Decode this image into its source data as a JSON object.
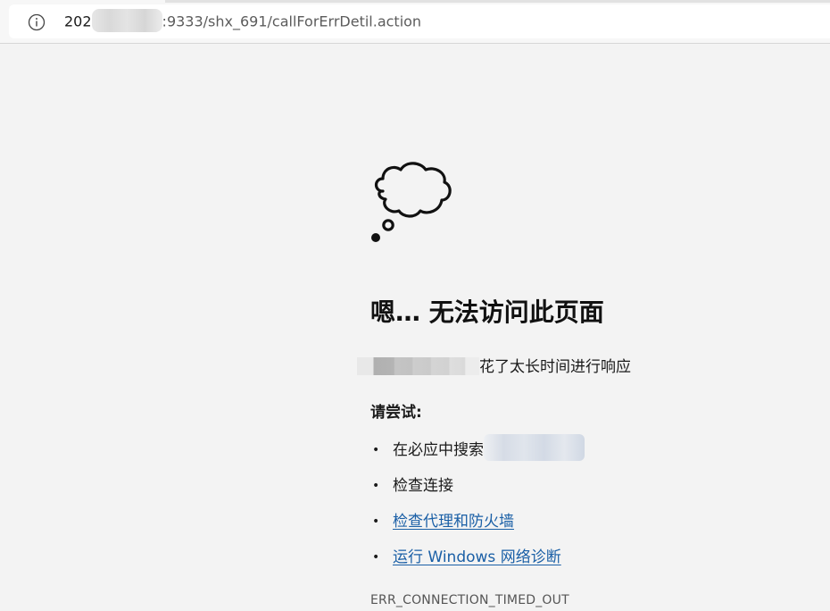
{
  "browser": {
    "url_prefix": "202",
    "url_suffix": ":9333/shx_691/callForErrDetil.action",
    "info_icon": "info-circle-icon"
  },
  "error_page": {
    "illustration_icon": "thought-cloud-icon",
    "title": "嗯… 无法访问此页面",
    "message_suffix": "花了太长时间进行响应",
    "try_heading": "请尝试:",
    "suggestions": [
      {
        "bullet": "•",
        "text": "在必应中搜索",
        "is_link": false
      },
      {
        "bullet": "•",
        "text": "检查连接",
        "is_link": false
      },
      {
        "bullet": "•",
        "text": "检查代理和防火墙",
        "is_link": true
      },
      {
        "bullet": "•",
        "text": "运行 Windows 网络诊断",
        "is_link": true
      }
    ],
    "error_code": "ERR_CONNECTION_TIMED_OUT"
  },
  "colors": {
    "page_background": "#f3f3f3",
    "link": "#1a5fa6",
    "text": "#1a1a1a"
  }
}
